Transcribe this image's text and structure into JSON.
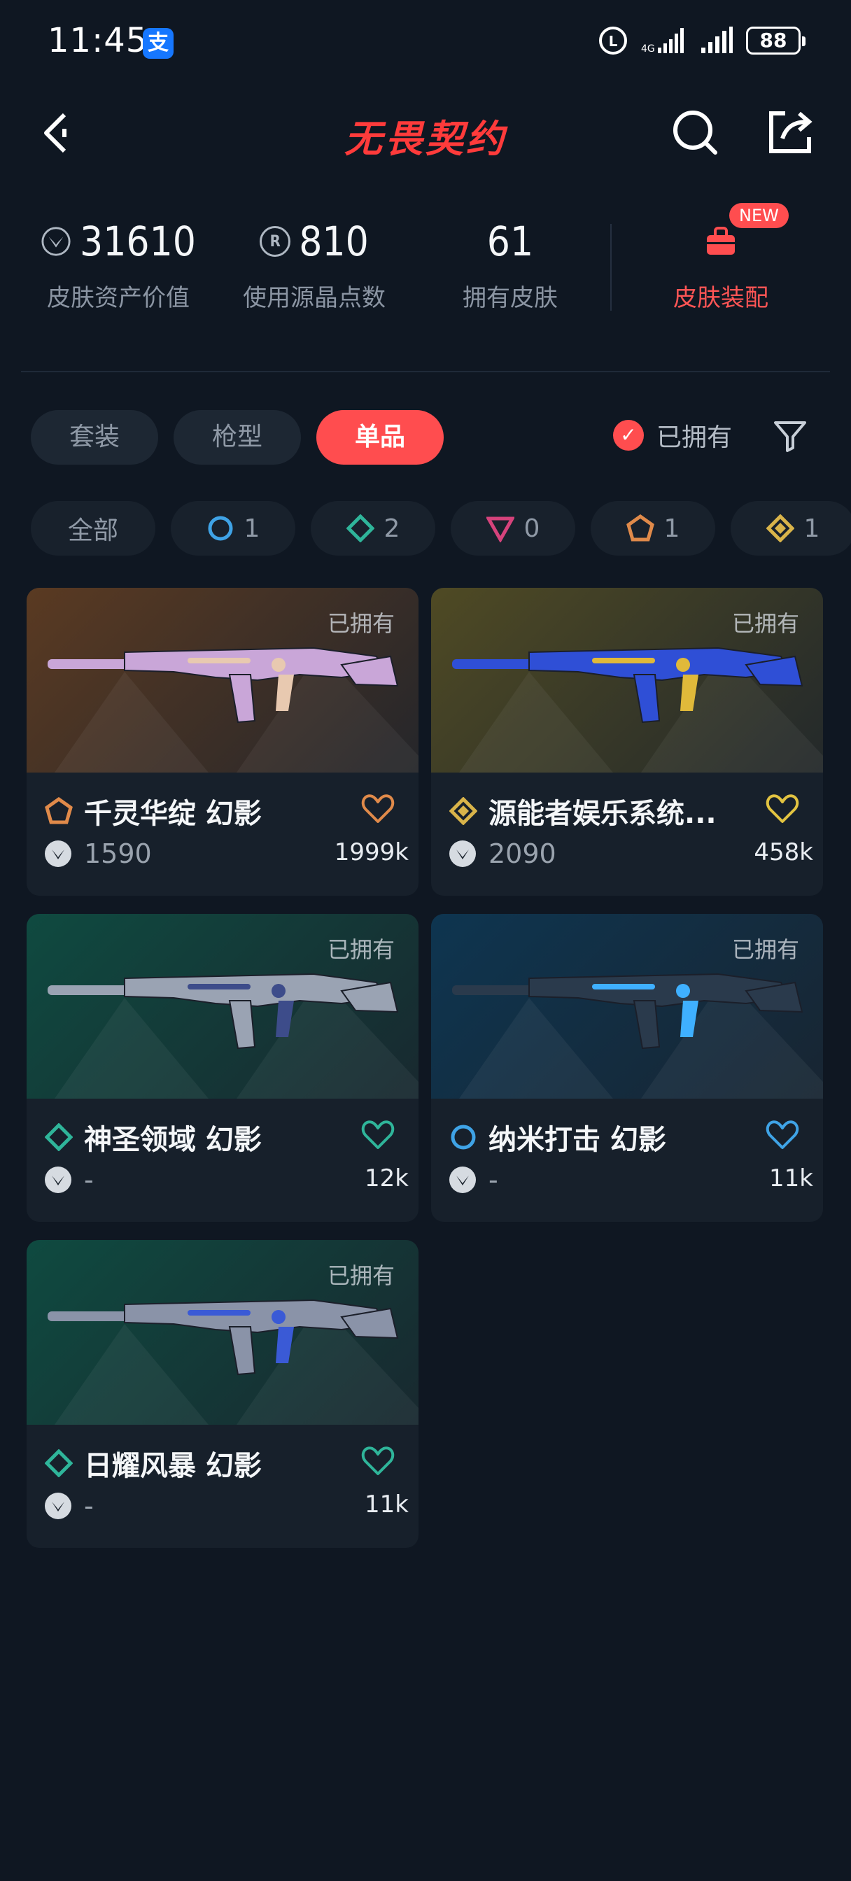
{
  "status_bar": {
    "time": "11:45",
    "alipay_glyph": "支",
    "network": "4G",
    "battery": "88"
  },
  "header": {
    "logo_text": "无畏契约"
  },
  "stats": {
    "asset_value": {
      "value": "31610",
      "label": "皮肤资产价值"
    },
    "radianite_points": {
      "value": "810",
      "label": "使用源晶点数",
      "icon_glyph": "R"
    },
    "owned_skins": {
      "value": "61",
      "label": "拥有皮肤"
    },
    "loadout": {
      "label": "皮肤装配",
      "badge": "NEW"
    }
  },
  "tabs": [
    {
      "label": "套装",
      "active": false
    },
    {
      "label": "枪型",
      "active": false
    },
    {
      "label": "单品",
      "active": true
    }
  ],
  "owned_filter": {
    "label": "已拥有",
    "checked": true
  },
  "rarity_chips": [
    {
      "label": "全部"
    },
    {
      "count": "1",
      "tier": "select",
      "color": "#3fa3e6"
    },
    {
      "count": "2",
      "tier": "deluxe",
      "color": "#2fb59a"
    },
    {
      "count": "0",
      "tier": "premium",
      "color": "#d6437c"
    },
    {
      "count": "1",
      "tier": "exclusive",
      "color": "#e08a4a"
    },
    {
      "count": "1",
      "tier": "ultra",
      "color": "#d9b44a"
    }
  ],
  "cards": [
    {
      "name": "千灵华绽 幻影",
      "owned": "已拥有",
      "price": "1590",
      "likes": "1999k",
      "tier_color": "#e08a4a",
      "heart_color": "#e08a4a",
      "bg": "#5a3a22"
    },
    {
      "name": "源能者娱乐系统...",
      "owned": "已拥有",
      "price": "2090",
      "likes": "458k",
      "tier_color": "#d9b44a",
      "heart_color": "#e2c341",
      "bg": "#4f4a24"
    },
    {
      "name": "神圣领域 幻影",
      "owned": "已拥有",
      "price": "-",
      "likes": "12k",
      "tier_color": "#2fb59a",
      "heart_color": "#2fb59a",
      "bg": "#0f4a40"
    },
    {
      "name": "纳米打击 幻影",
      "owned": "已拥有",
      "price": "-",
      "likes": "11k",
      "tier_color": "#3fa3e6",
      "heart_color": "#3fa3e6",
      "bg": "#0e3550"
    },
    {
      "name": "日耀风暴 幻影",
      "owned": "已拥有",
      "price": "-",
      "likes": "11k",
      "tier_color": "#2fb59a",
      "heart_color": "#2fb59a",
      "bg": "#0f4a40"
    }
  ]
}
